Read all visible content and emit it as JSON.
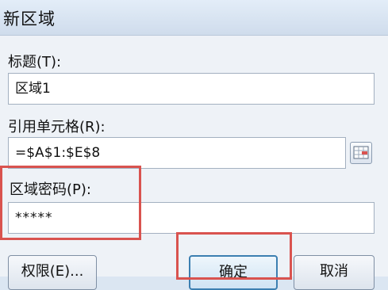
{
  "dialog": {
    "title": "新区域",
    "title_label": "标题(T):",
    "title_value": "区域1",
    "ref_label": "引用单元格(R):",
    "ref_value": "=$A$1:$E$8",
    "password_label": "区域密码(P):",
    "password_value": "*****"
  },
  "buttons": {
    "permissions": "权限(E)...",
    "ok": "确定",
    "cancel": "取消"
  },
  "colors": {
    "highlight": "#d9534f",
    "primary_border": "#3c7fb1"
  }
}
